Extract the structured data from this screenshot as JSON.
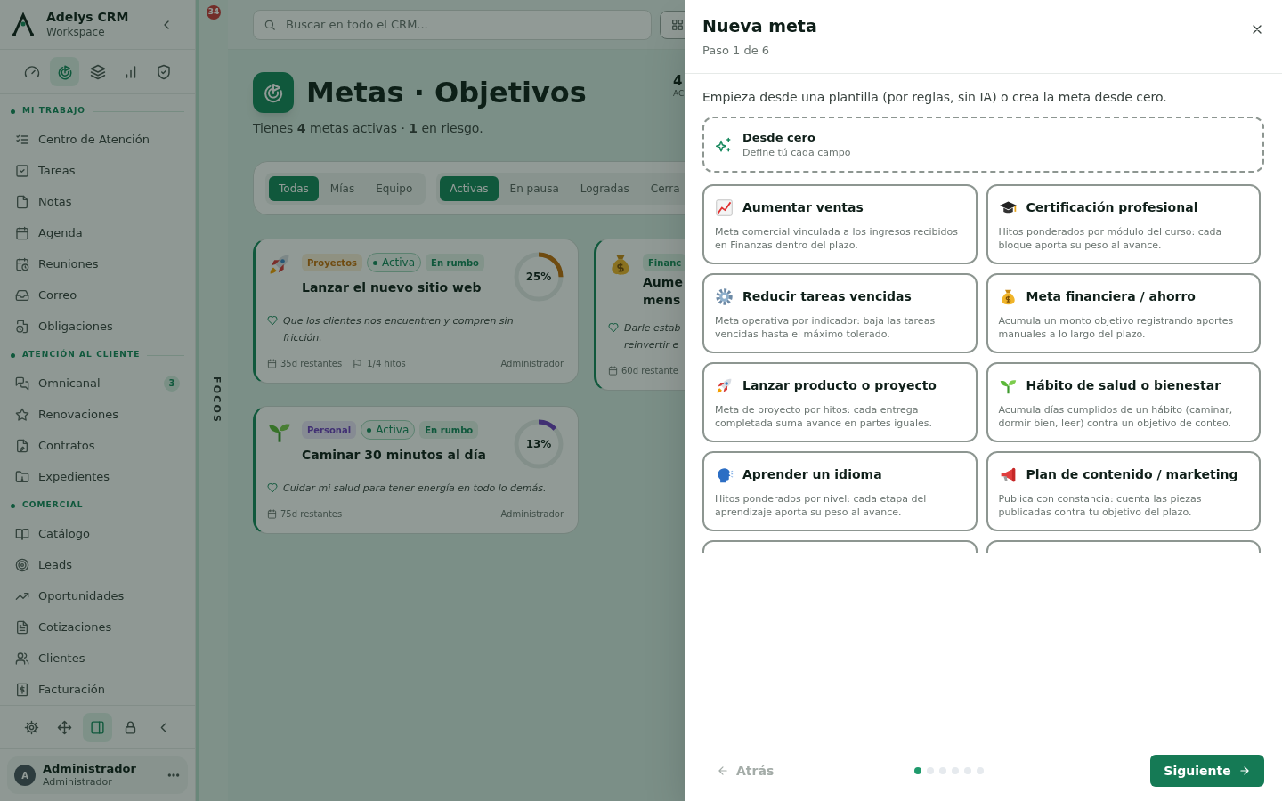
{
  "sidebar": {
    "brand": "Adelys CRM",
    "workspace": "Workspace",
    "top_icons": [
      {
        "selected": false
      },
      {
        "selected": true
      },
      {
        "selected": false
      },
      {
        "selected": false
      },
      {
        "selected": false
      }
    ],
    "sections": [
      {
        "title": "MI TRABAJO",
        "items": [
          {
            "label": "Centro de Atención"
          },
          {
            "label": "Tareas"
          },
          {
            "label": "Notas"
          },
          {
            "label": "Agenda"
          },
          {
            "label": "Reuniones"
          },
          {
            "label": "Correo"
          },
          {
            "label": "Obligaciones"
          }
        ]
      },
      {
        "title": "ATENCIÓN AL CLIENTE",
        "items": [
          {
            "label": "Omnicanal",
            "badge": "3"
          },
          {
            "label": "Renovaciones"
          },
          {
            "label": "Contratos"
          },
          {
            "label": "Expedientes"
          }
        ]
      },
      {
        "title": "COMERCIAL",
        "items": [
          {
            "label": "Catálogo"
          },
          {
            "label": "Leads"
          },
          {
            "label": "Oportunidades"
          },
          {
            "label": "Cotizaciones"
          },
          {
            "label": "Clientes"
          },
          {
            "label": "Facturación"
          }
        ]
      }
    ],
    "tools": [
      {
        "selected": false
      },
      {
        "selected": false
      },
      {
        "selected": true
      },
      {
        "selected": false
      },
      {
        "selected": false
      }
    ],
    "user": {
      "initial": "A",
      "name": "Administrador",
      "role": "Administrador"
    }
  },
  "strip": {
    "badge": "34",
    "label": "FOCOS"
  },
  "search": {
    "placeholder": "Buscar en todo el CRM..."
  },
  "header": {
    "title": "Metas · Objetivos",
    "subtitle": "Tienes **4** metas activas · **1** en riesgo.",
    "stat_value": "4",
    "stat_label": "AC"
  },
  "filters": [
    [
      {
        "label": "Todas",
        "selected": true
      },
      {
        "label": "Mías",
        "selected": false
      },
      {
        "label": "Equipo",
        "selected": false
      }
    ],
    [
      {
        "label": "Activas",
        "selected": true
      },
      {
        "label": "En pausa",
        "selected": false
      },
      {
        "label": "Logradas",
        "selected": false
      },
      {
        "label": "Cerra",
        "selected": false
      }
    ]
  ],
  "goals": [
    {
      "category": "Proyectos",
      "kind": "project",
      "status": "Activa",
      "health": "En rumbo",
      "title_lines": [
        "Lanzar el nuevo sitio web"
      ],
      "level": 0.25,
      "reading": "25%",
      "quote": "Que los clientes nos encuentren y compren sin fricción.",
      "remaining": "35d restantes",
      "milestones": "1/4 hitos",
      "owner": "Administrador"
    },
    {
      "category": "Financ",
      "kind": "finance",
      "title_lines": [
        "Aume",
        "mens"
      ],
      "quote_lines": [
        "Darle estab",
        "reinvertir e"
      ],
      "remaining": "60d restante"
    },
    {
      "category": "Personal",
      "kind": "personal",
      "status": "Activa",
      "health": "En rumbo",
      "title_lines": [
        "Caminar 30 minutos al día"
      ],
      "level": 0.13,
      "reading": "13%",
      "quote": "Cuidar mi salud para tener energía en todo lo demás.",
      "remaining": "75d restantes",
      "owner": "Administrador"
    }
  ],
  "drawer": {
    "title": "Nueva meta",
    "step": "Paso 1 de 6",
    "intro": "Empieza desde una plantilla (por reglas, sin IA) o crea la meta desde cero.",
    "blank": {
      "title": "Desde cero",
      "description": "Define tú cada campo"
    },
    "templates": [
      {
        "title": "Aumentar ventas",
        "description": "Meta comercial vinculada a los ingresos recibidos en Finanzas dentro del plazo."
      },
      {
        "title": "Certificación profesional",
        "description": "Hitos ponderados por módulo del curso: cada bloque aporta su peso al avance."
      },
      {
        "title": "Reducir tareas vencidas",
        "description": "Meta operativa por indicador: baja las tareas vencidas hasta el máximo tolerado."
      },
      {
        "title": "Meta financiera / ahorro",
        "description": "Acumula un monto objetivo registrando aportes manuales a lo largo del plazo."
      },
      {
        "title": "Lanzar producto o proyecto",
        "description": "Meta de proyecto por hitos: cada entrega completada suma avance en partes iguales."
      },
      {
        "title": "Hábito de salud o bienestar",
        "description": "Acumula días cumplidos de un hábito (caminar, dormir bien, leer) contra un objetivo de conteo."
      },
      {
        "title": "Aprender un idioma",
        "description": "Hitos ponderados por nivel: cada etapa del aprendizaje aporta su peso al avance."
      },
      {
        "title": "Plan de contenido / marketing",
        "description": "Publica con constancia: cuenta las piezas publicadas contra tu objetivo del plazo."
      }
    ],
    "back": {
      "label": "Atrás",
      "disabled": true
    },
    "steps": [
      {
        "selected": true
      },
      {
        "selected": false
      },
      {
        "selected": false
      },
      {
        "selected": false
      },
      {
        "selected": false
      },
      {
        "selected": false
      }
    ],
    "next": {
      "label": "Siguiente"
    }
  }
}
